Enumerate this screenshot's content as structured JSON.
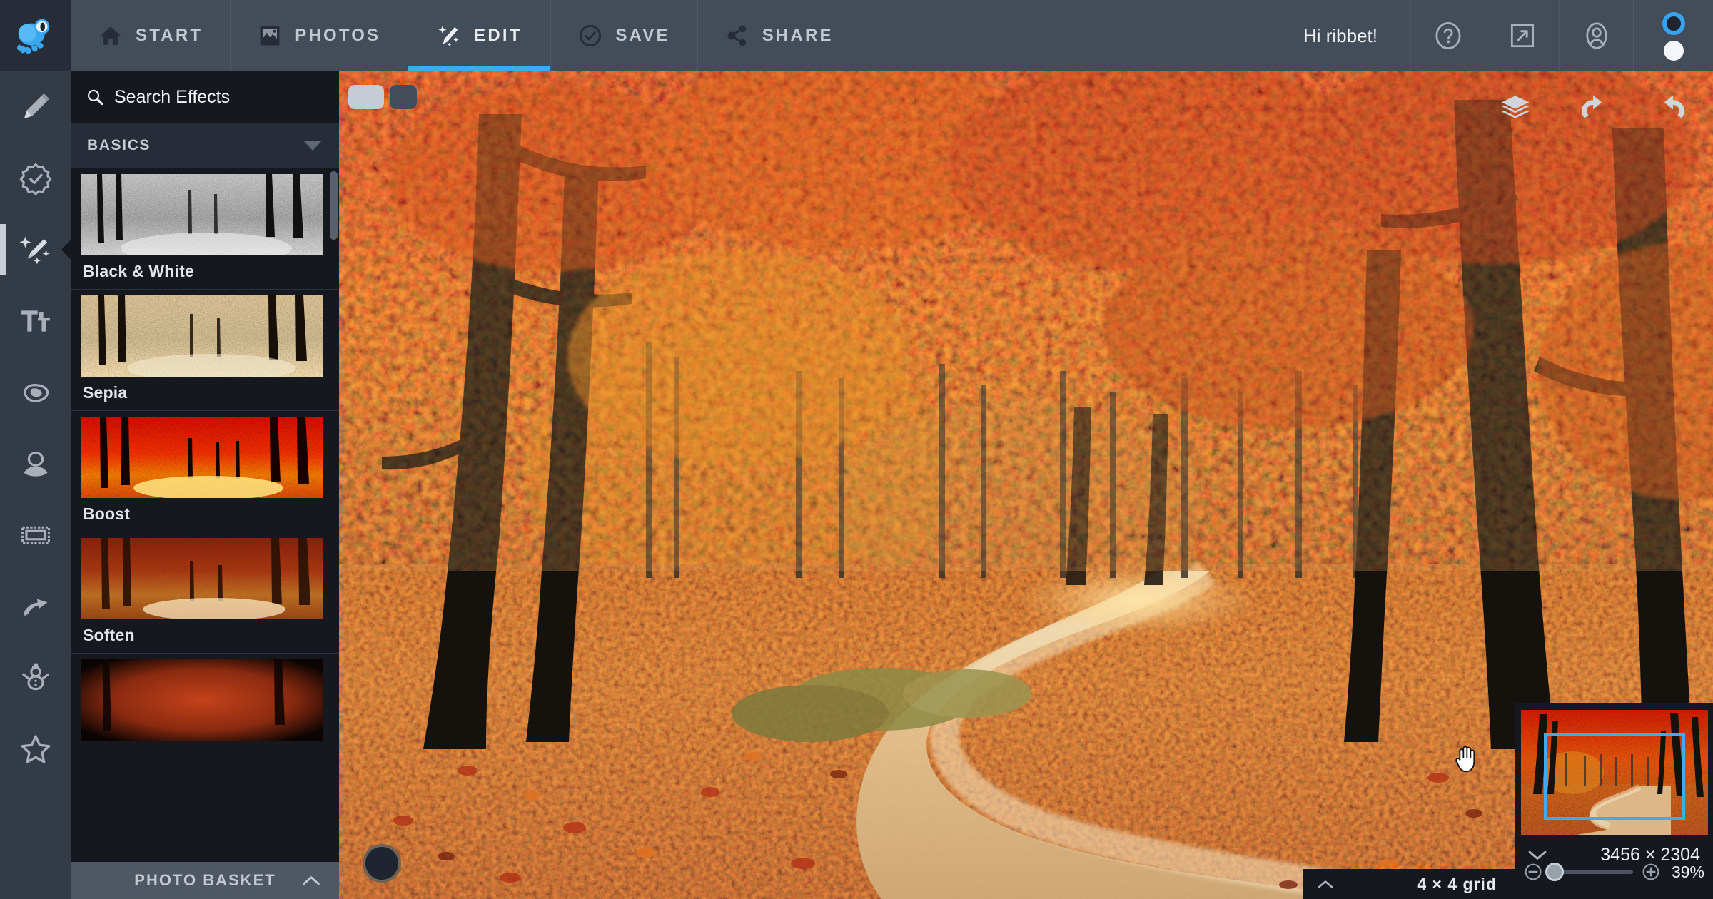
{
  "app": {
    "name": "PicMonkey",
    "logo_icon": "frog-logo-icon",
    "accent_color": "#3faaf0",
    "topbar_bg": "#434c59",
    "panel_bg": "#15181e"
  },
  "topbar": {
    "tabs": [
      {
        "label": "START",
        "icon": "home-icon",
        "active": false
      },
      {
        "label": "PHOTOS",
        "icon": "photo-icon",
        "active": false
      },
      {
        "label": "EDIT",
        "icon": "magic-wand-icon",
        "active": true
      },
      {
        "label": "SAVE",
        "icon": "check-circle-icon",
        "active": false
      },
      {
        "label": "SHARE",
        "icon": "share-nodes-icon",
        "active": false
      }
    ],
    "greeting": "Hi ribbet!",
    "actions": [
      {
        "name": "help-icon",
        "label": "Help"
      },
      {
        "name": "fullscreen-icon",
        "label": "Fullscreen"
      },
      {
        "name": "account-icon",
        "label": "Account"
      }
    ],
    "avatar": {
      "name": "avatar",
      "ring_color": "#36a3ef",
      "body_color": "#f4f7f9"
    }
  },
  "rail": {
    "items": [
      {
        "label": "Basic Edits",
        "icon": "pencil-icon",
        "active": false
      },
      {
        "label": "Touch Up",
        "icon": "badge-check-icon",
        "active": false
      },
      {
        "label": "Effects",
        "icon": "magic-wand-icon",
        "active": true
      },
      {
        "label": "Text",
        "icon": "text-tt-icon",
        "active": false
      },
      {
        "label": "Textures",
        "icon": "blob-icon",
        "active": false
      },
      {
        "label": "Overlays",
        "icon": "portrait-icon",
        "active": false
      },
      {
        "label": "Frames",
        "icon": "frame-icon",
        "active": false
      },
      {
        "label": "Themes",
        "icon": "ribbon-icon",
        "active": false
      },
      {
        "label": "Seasonal",
        "icon": "snowman-icon",
        "active": false
      },
      {
        "label": "Favorites",
        "icon": "star-icon",
        "active": false
      }
    ]
  },
  "panel": {
    "search": {
      "icon": "search-icon",
      "placeholder": "Search Effects",
      "value": ""
    },
    "toggles": [
      {
        "name": "view-toggle-grid",
        "state": "on"
      },
      {
        "name": "view-toggle-list",
        "state": "off"
      }
    ],
    "section": {
      "title": "BASICS",
      "caret": "chevron-down-icon",
      "expanded": true
    },
    "effects": [
      {
        "name": "Black & White",
        "thumb": "bw"
      },
      {
        "name": "Sepia",
        "thumb": "sepia"
      },
      {
        "name": "Boost",
        "thumb": "boost"
      },
      {
        "name": "Soften",
        "thumb": "soften"
      },
      {
        "name": "",
        "thumb": "vignette"
      }
    ],
    "footer": {
      "label": "PHOTO BASKET",
      "chevron": "chevron-up-icon"
    }
  },
  "canvas": {
    "image_alt": "Autumn forest path with red and orange foliage",
    "cursor": "grab-hand-cursor",
    "tools": [
      {
        "name": "layers-icon",
        "label": "Layers"
      },
      {
        "name": "undo-icon",
        "label": "Undo"
      },
      {
        "name": "redo-icon",
        "label": "Redo"
      }
    ],
    "rotate_knob": {
      "name": "rotate-knob"
    },
    "grid_bar": {
      "chevron": "chevron-up-icon",
      "value": "4",
      "separator": "×",
      "value2": "4",
      "label": "grid",
      "text": "4 × 4  grid"
    }
  },
  "navigator": {
    "dimensions": "3456 × 2304",
    "width_px": "3456",
    "height_px": "2304",
    "collapse_icon": "chevron-down-icon",
    "zoom": {
      "minus_icon": "zoom-out-icon",
      "plus_icon": "zoom-in-icon",
      "percent": "39%",
      "value": 39,
      "slider_position_pct": 4
    }
  }
}
